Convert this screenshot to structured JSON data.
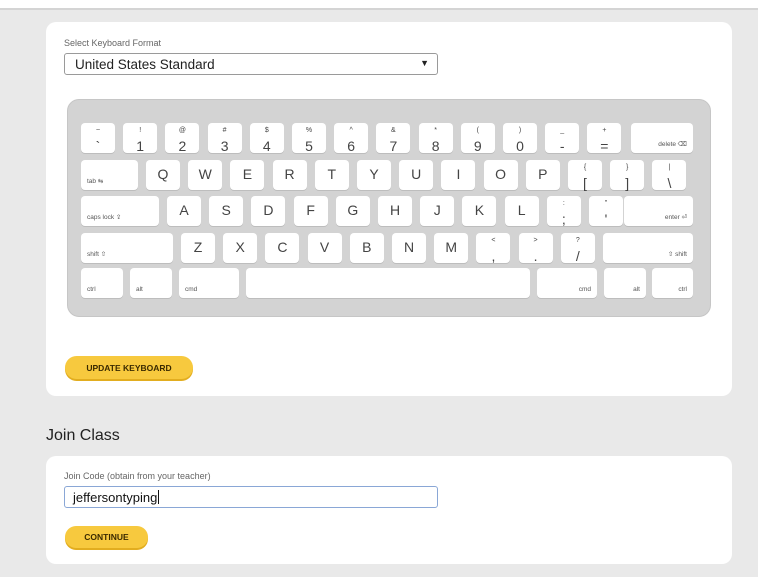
{
  "keyboard_section": {
    "format_label": "Select Keyboard Format",
    "format_value": "United States Standard",
    "update_button": "UPDATE KEYBOARD"
  },
  "keyboard": {
    "row1": [
      {
        "up": "~",
        "dn": "`"
      },
      {
        "up": "!",
        "dn": "1"
      },
      {
        "up": "@",
        "dn": "2"
      },
      {
        "up": "#",
        "dn": "3"
      },
      {
        "up": "$",
        "dn": "4"
      },
      {
        "up": "%",
        "dn": "5"
      },
      {
        "up": "^",
        "dn": "6"
      },
      {
        "up": "&",
        "dn": "7"
      },
      {
        "up": "*",
        "dn": "8"
      },
      {
        "up": "(",
        "dn": "9"
      },
      {
        "up": ")",
        "dn": "0"
      },
      {
        "up": "_",
        "dn": "-"
      },
      {
        "up": "+",
        "dn": "="
      }
    ],
    "delete_label": "delete ⌫",
    "tab_label": "tab ⇆",
    "row2": [
      "Q",
      "W",
      "E",
      "R",
      "T",
      "Y",
      "U",
      "I",
      "O",
      "P"
    ],
    "row2_sym": [
      {
        "up": "{",
        "dn": "["
      },
      {
        "up": "}",
        "dn": "]"
      },
      {
        "up": "|",
        "dn": "\\"
      }
    ],
    "caps_label": "caps lock ⇪",
    "row3": [
      "A",
      "S",
      "D",
      "F",
      "G",
      "H",
      "J",
      "K",
      "L"
    ],
    "row3_sym": [
      {
        "up": ":",
        "dn": ";"
      },
      {
        "up": "\"",
        "dn": "'"
      }
    ],
    "enter_label": "enter ⏎",
    "shift_left_label": "shift ⇧",
    "row4": [
      "Z",
      "X",
      "C",
      "V",
      "B",
      "N",
      "M"
    ],
    "row4_sym": [
      {
        "up": "<",
        "dn": ","
      },
      {
        "up": ">",
        "dn": "."
      },
      {
        "up": "?",
        "dn": "/"
      }
    ],
    "shift_right_label": "⇧ shift",
    "ctrl_label": "ctrl",
    "alt_label": "alt",
    "cmd_label": "cmd"
  },
  "join_class": {
    "title": "Join Class",
    "code_label": "Join Code (obtain from your teacher)",
    "code_value": "jeffersontyping",
    "continue_button": "CONTINUE"
  }
}
